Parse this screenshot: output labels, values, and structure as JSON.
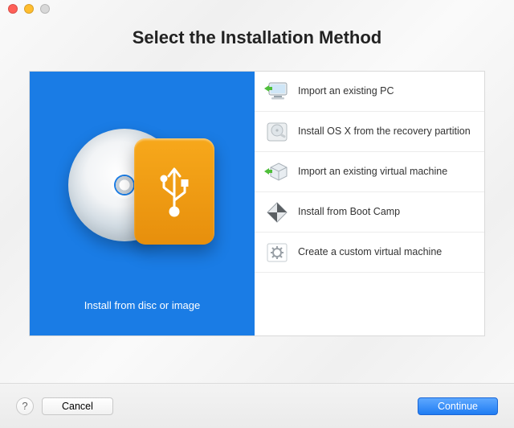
{
  "header": {
    "title": "Select the Installation Method"
  },
  "hero": {
    "label": "Install from disc or image"
  },
  "options": [
    {
      "label": "Import an existing PC",
      "icon": "monitor-arrow-icon"
    },
    {
      "label": "Install OS X from the recovery partition",
      "icon": "harddrive-icon"
    },
    {
      "label": "Import an existing virtual machine",
      "icon": "cube-arrow-icon"
    },
    {
      "label": "Install from Boot Camp",
      "icon": "bootcamp-icon"
    },
    {
      "label": "Create a custom virtual machine",
      "icon": "gear-frame-icon"
    }
  ],
  "footer": {
    "help_label": "?",
    "cancel_label": "Cancel",
    "continue_label": "Continue"
  }
}
